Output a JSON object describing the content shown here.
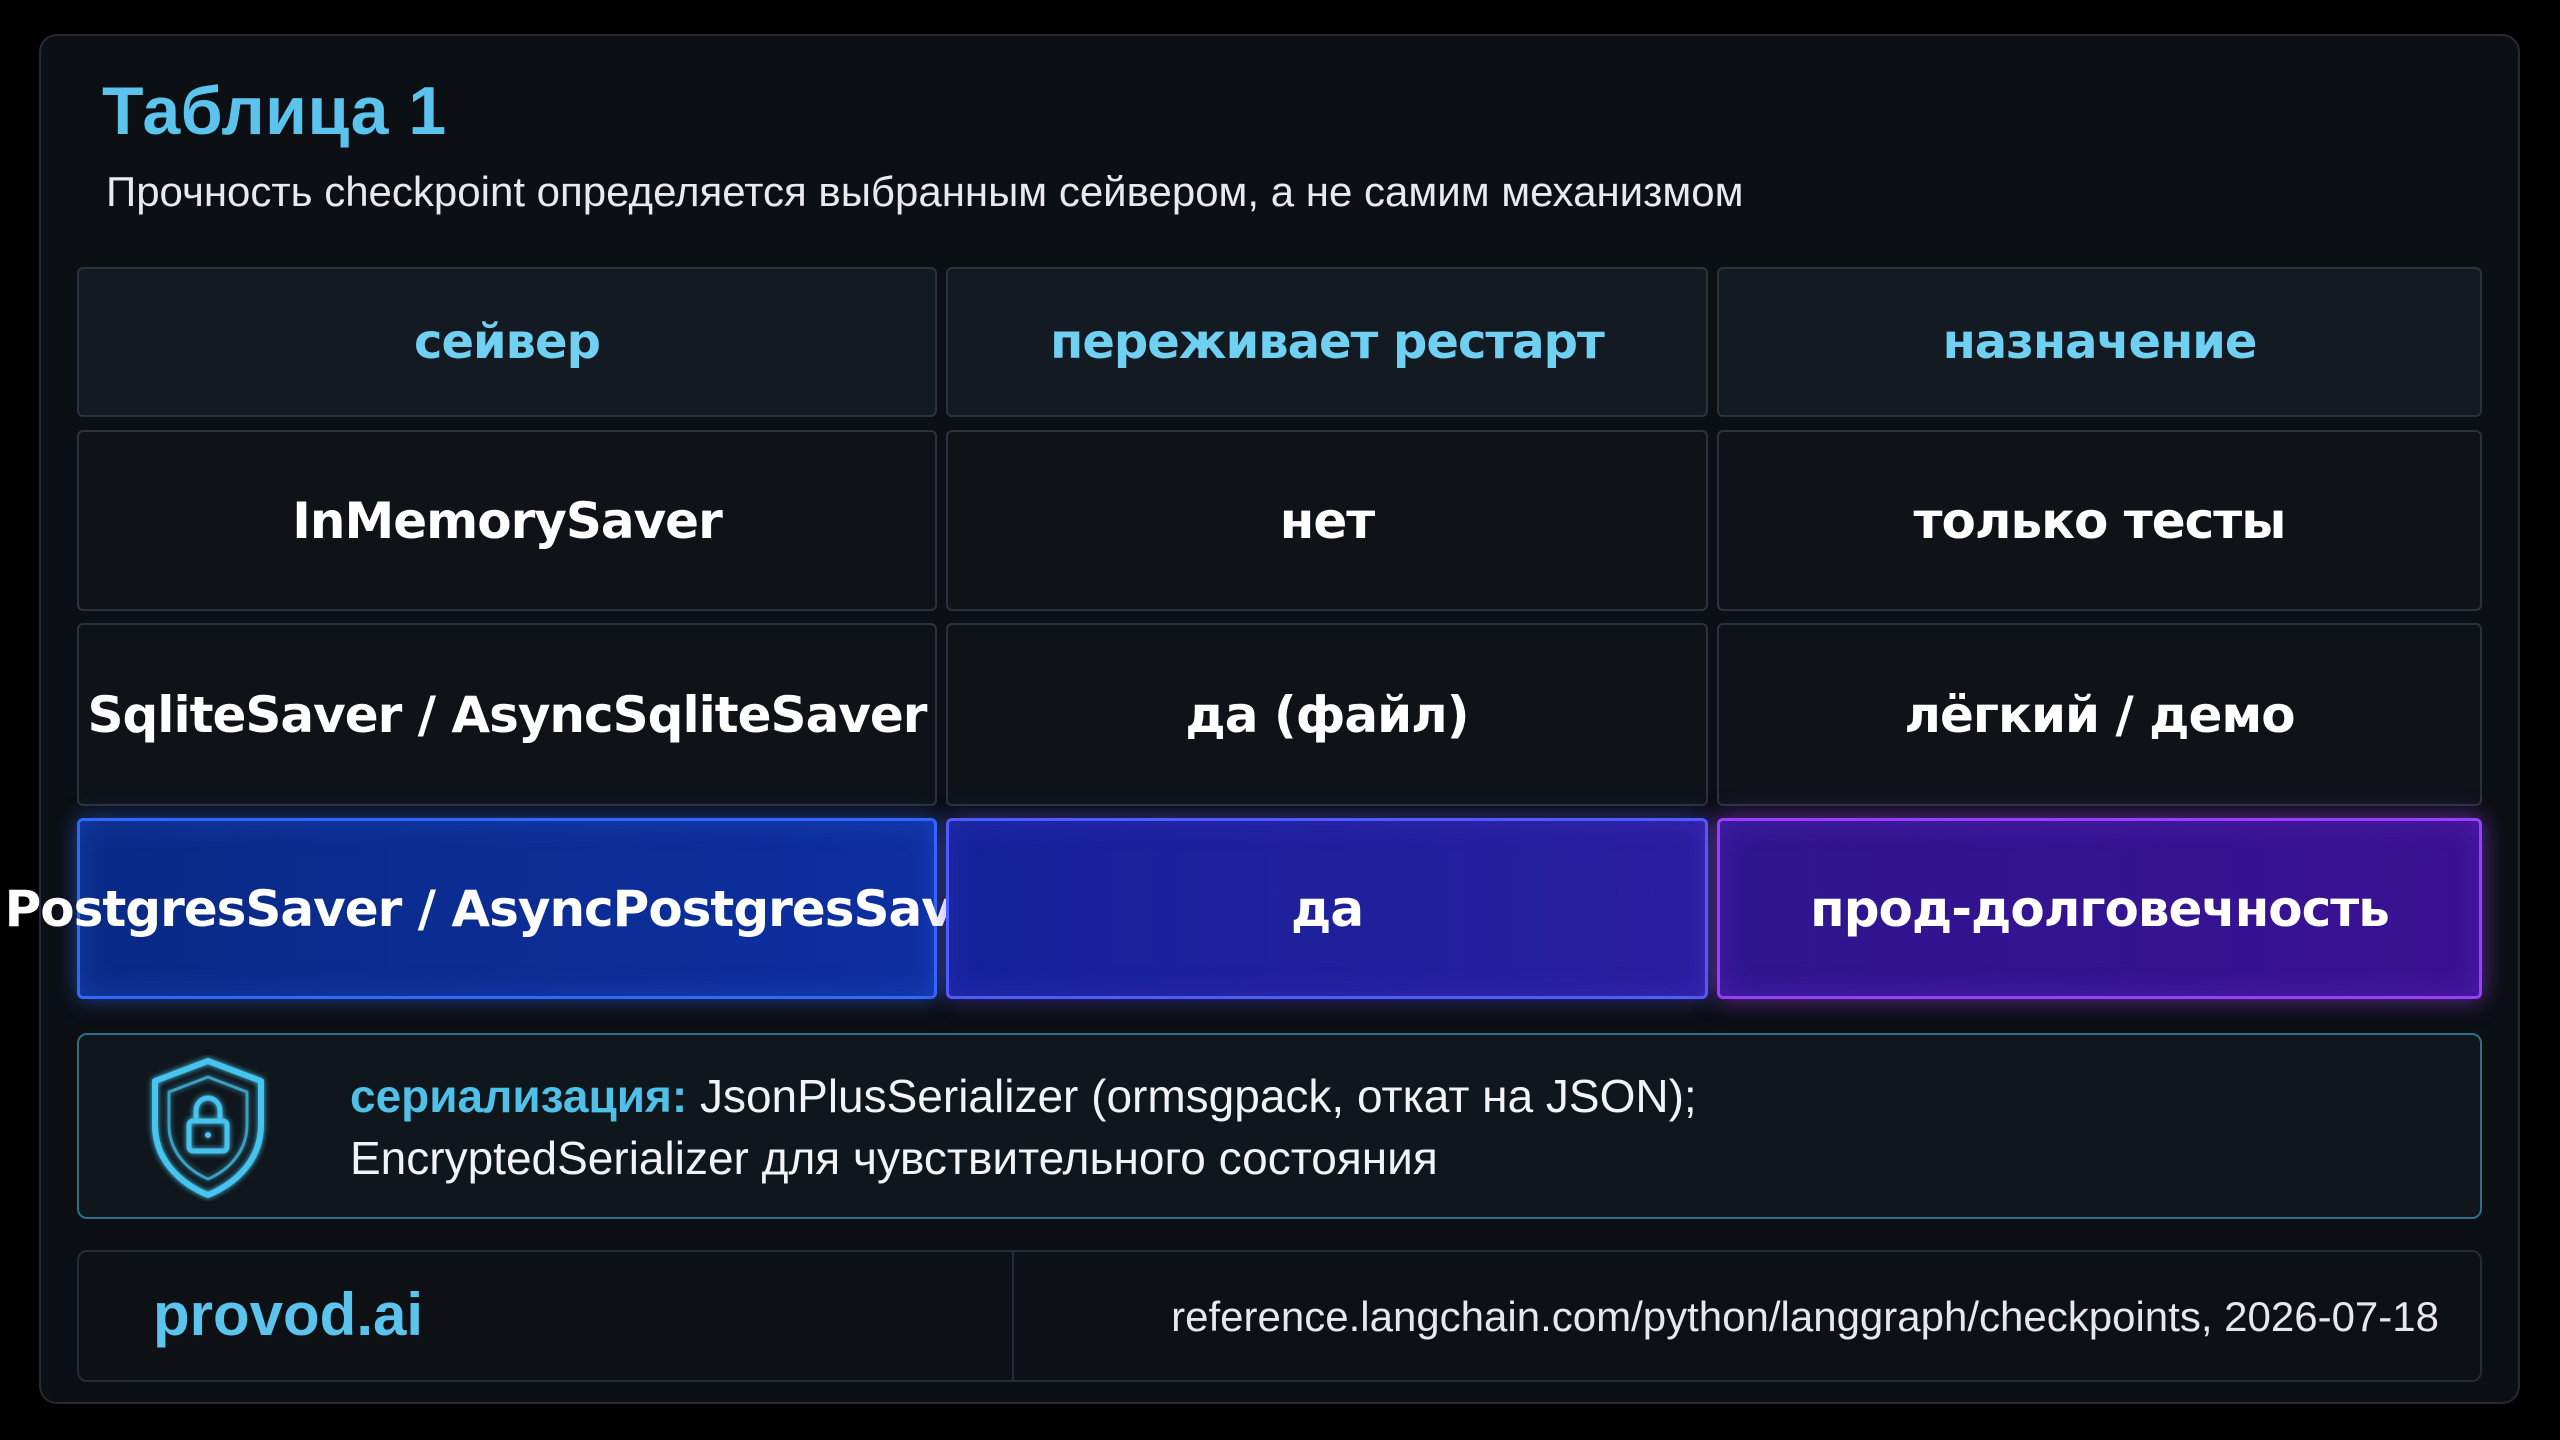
{
  "title": "Таблица 1",
  "subtitle": "Прочность checkpoint определяется выбранным сейвером, а не самим механизмом",
  "table": {
    "headers": [
      "сейвер",
      "переживает рестарт",
      "назначение"
    ],
    "rows": [
      [
        "InMemorySaver",
        "нет",
        "только тесты"
      ],
      [
        "SqliteSaver / AsyncSqliteSaver",
        "да (файл)",
        "лёгкий / демо"
      ],
      [
        "PostgresSaver / AsyncPostgresSaver",
        "да",
        "прод-долговечность"
      ]
    ],
    "highlighted_row": 2
  },
  "note": {
    "icon": "shield-lock-icon",
    "key": "сериализация:",
    "line1": " JsonPlusSerializer (ormsgpack, откат на JSON);",
    "line2": "EncryptedSerializer для чувствительного состояния"
  },
  "footer": {
    "brand": "provod.ai",
    "source": "reference.langchain.com/python/langgraph/checkpoints, 2026-07-18"
  },
  "colors": {
    "accent": "#5cc4ec",
    "highlight_blue": "#2f68ff",
    "highlight_purple": "#9a3dff",
    "background": "#000000"
  }
}
